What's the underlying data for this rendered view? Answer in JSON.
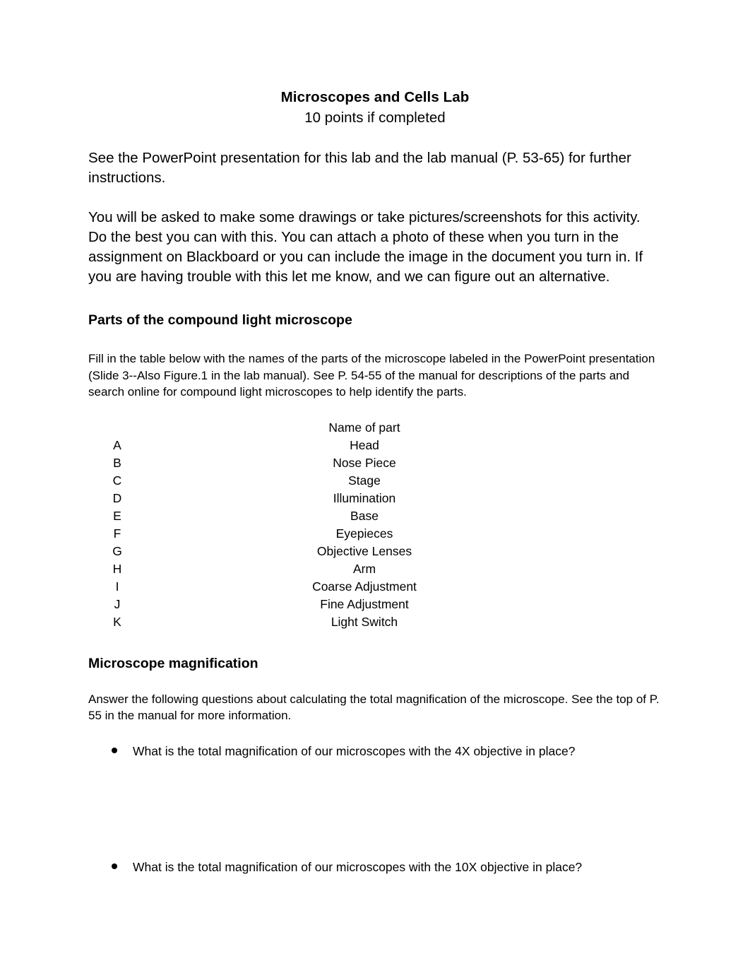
{
  "document": {
    "title": "Microscopes and Cells Lab",
    "subtitle": "10 points if completed",
    "intro_paragraph": "See the PowerPoint presentation for this lab and the lab manual (P. 53-65) for further instructions.",
    "instructions_paragraph": "You will be asked to make some drawings or take pictures/screenshots for this activity. Do the best you can with this. You can attach a photo of these when you turn in the assignment on Blackboard or you can include the image in the document you turn in. If you are having trouble with this let me know, and we can figure out an alternative."
  },
  "section_parts": {
    "heading": "Parts of the compound light microscope",
    "instructions": "Fill in the table below with the names of the parts of the microscope labeled in the PowerPoint presentation (Slide 3--Also Figure.1 in the lab manual). See P. 54-55 of the manual for descriptions of the parts and search online for compound light microscopes to help identify the parts.",
    "table": {
      "header_letter": "",
      "header_name": "Name of part",
      "rows": [
        {
          "letter": "A",
          "name": "Head"
        },
        {
          "letter": "B",
          "name": "Nose Piece"
        },
        {
          "letter": "C",
          "name": "Stage"
        },
        {
          "letter": "D",
          "name": "Illumination"
        },
        {
          "letter": "E",
          "name": "Base"
        },
        {
          "letter": "F",
          "name": "Eyepieces"
        },
        {
          "letter": "G",
          "name": "Objective Lenses"
        },
        {
          "letter": "H",
          "name": "Arm"
        },
        {
          "letter": "I",
          "name": "Coarse Adjustment"
        },
        {
          "letter": "J",
          "name": "Fine Adjustment"
        },
        {
          "letter": "K",
          "name": "Light Switch"
        }
      ]
    }
  },
  "section_magnification": {
    "heading": "Microscope magnification",
    "instructions": "Answer the following questions about calculating the total magnification of the microscope. See the top of P. 55 in the manual for more information.",
    "questions": [
      "What is the total magnification of our microscopes with the 4X objective in place?",
      "What is the total magnification of our microscopes with the 10X objective in place?"
    ]
  },
  "colors": {
    "page_background": "#ffffff",
    "text": "#000000"
  }
}
